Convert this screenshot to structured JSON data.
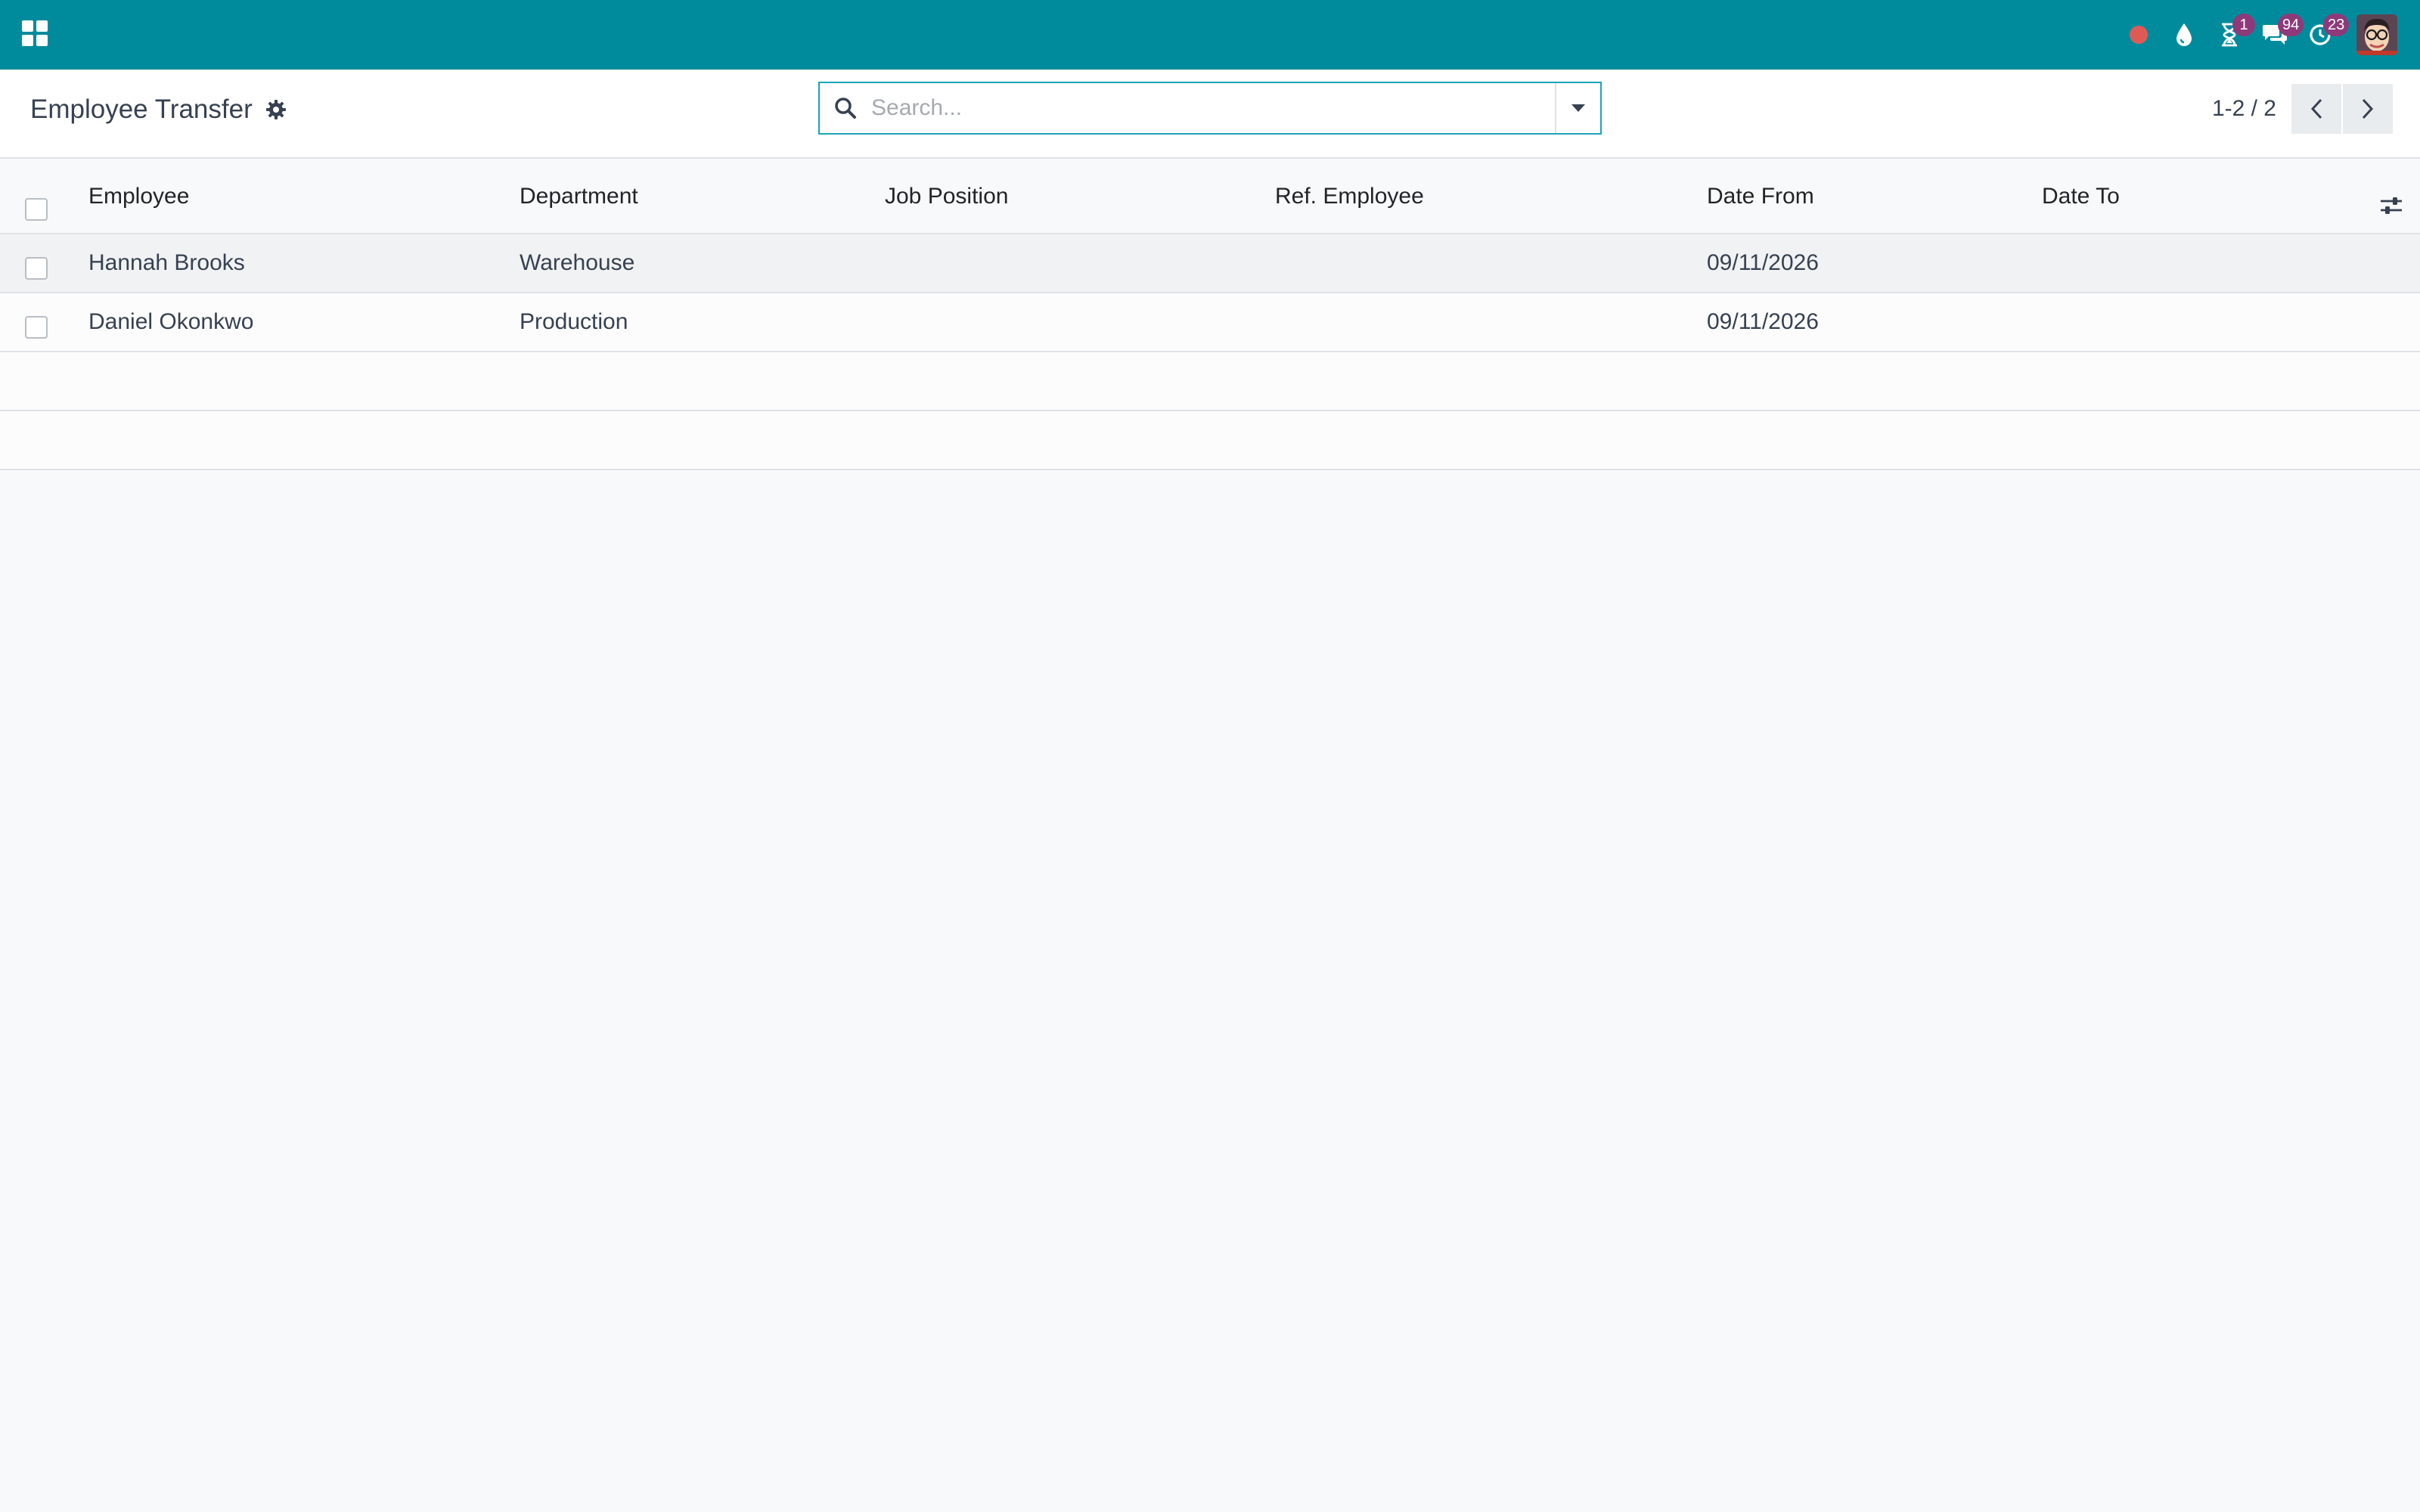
{
  "navbar": {
    "badges": {
      "activities": "1",
      "messages": "94",
      "updates": "23"
    }
  },
  "control_panel": {
    "title": "Employee Transfer",
    "search_placeholder": "Search...",
    "pager": "1-2 / 2"
  },
  "list": {
    "columns": {
      "employee": "Employee",
      "department": "Department",
      "job_position": "Job Position",
      "ref_employee": "Ref. Employee",
      "date_from": "Date From",
      "date_to": "Date To"
    },
    "rows": [
      {
        "employee": "Hannah Brooks",
        "department": "Warehouse",
        "job_position": "",
        "ref_employee": "",
        "date_from": "09/11/2026",
        "date_to": ""
      },
      {
        "employee": "Daniel Okonkwo",
        "department": "Production",
        "job_position": "",
        "ref_employee": "",
        "date_from": "09/11/2026",
        "date_to": ""
      }
    ]
  },
  "colors": {
    "navbar": "#008b9c",
    "badge": "#8e3a7a",
    "recording_dot": "#e05a55"
  }
}
